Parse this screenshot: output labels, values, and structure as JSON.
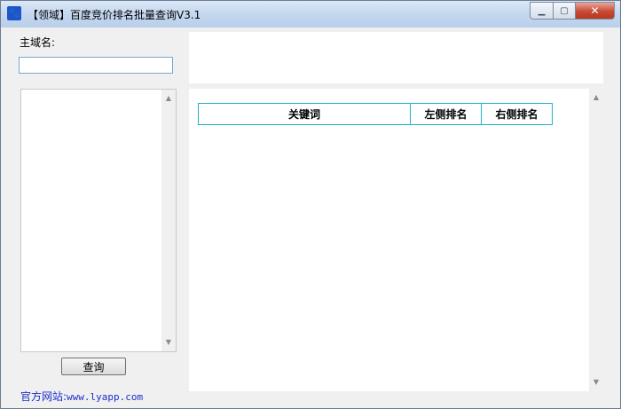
{
  "window": {
    "title": "【领域】百度竞价排名批量查询V3.1",
    "app_icon": "paw-icon",
    "buttons": {
      "minimize": "minimize-icon",
      "maximize": "maximize-icon",
      "close": "close-icon"
    }
  },
  "form": {
    "domain_label": "主域名:",
    "domain_value": "",
    "keyword_list": [],
    "query_button": "查询"
  },
  "footer": {
    "site_label": "官方网站:",
    "site_url": "www.lyapp.com"
  },
  "results": {
    "columns": [
      "关键词",
      "左侧排名",
      "右侧排名"
    ],
    "rows": []
  },
  "colors": {
    "table_border": "#1fb3c9",
    "link": "#1a2fcc",
    "input_border": "#7ba7d6"
  }
}
